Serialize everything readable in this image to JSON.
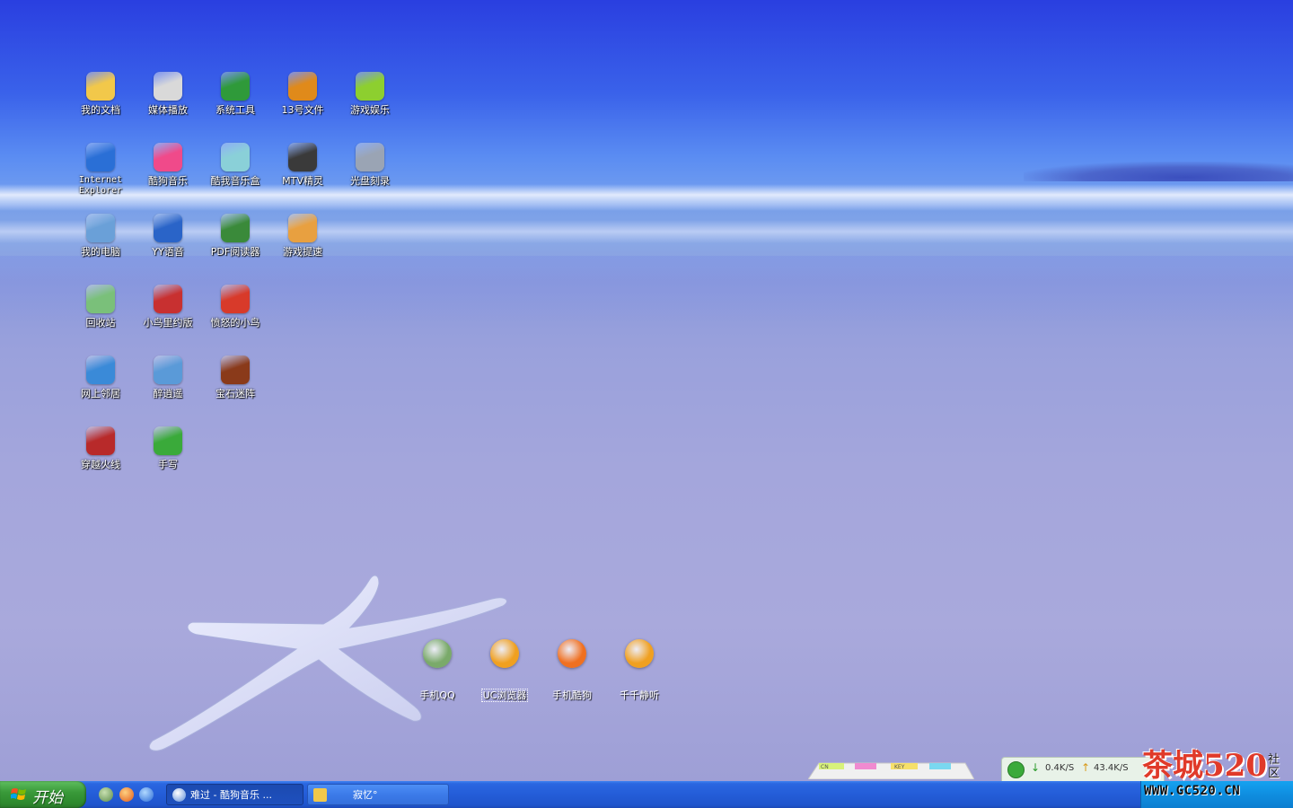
{
  "desktop_icons": [
    {
      "label": "我的文档",
      "icon": "my-documents-icon",
      "color": "#f2c84a"
    },
    {
      "label": "媒体播放",
      "icon": "media-player-icon",
      "color": "#d9d9d9"
    },
    {
      "label": "系统工具",
      "icon": "system-tools-icon",
      "color": "#2f9a3a"
    },
    {
      "label": "13号文件",
      "icon": "file-box-icon",
      "color": "#e08a1a"
    },
    {
      "label": "游戏娱乐",
      "icon": "android-games-icon",
      "color": "#8dcf2f"
    },
    {
      "label": "Internet Explorer",
      "icon": "internet-explorer-icon",
      "color": "#2a6fd6"
    },
    {
      "label": "酷狗音乐",
      "icon": "kugou-music-icon",
      "color": "#f04a8a"
    },
    {
      "label": "酷我音乐盒",
      "icon": "kuwo-music-icon",
      "color": "#8ad0d8"
    },
    {
      "label": "MTV精灵",
      "icon": "mtv-speaker-icon",
      "color": "#3a3a3a"
    },
    {
      "label": "光盘刻录",
      "icon": "disc-burner-icon",
      "color": "#9aa4b4"
    },
    {
      "label": "我的电脑",
      "icon": "my-computer-icon",
      "color": "#6aa0d8"
    },
    {
      "label": "YY语音",
      "icon": "yy-voice-icon",
      "color": "#2a64c8"
    },
    {
      "label": "PDF阅读器",
      "icon": "pdf-reader-icon",
      "color": "#3a8a3a"
    },
    {
      "label": "游戏提速",
      "icon": "game-boost-icon",
      "color": "#e8a040"
    },
    {
      "label": "回收站",
      "icon": "recycle-bin-icon",
      "color": "#7ac07a"
    },
    {
      "label": "小鸟里约版",
      "icon": "angry-birds-rio-icon",
      "color": "#c83030"
    },
    {
      "label": "愤怒的小鸟",
      "icon": "angry-birds-icon",
      "color": "#d83a2a"
    },
    {
      "label": "网上邻居",
      "icon": "network-places-icon",
      "color": "#3a8ad8"
    },
    {
      "label": "醉逍遥",
      "icon": "zuixiaoyao-icon",
      "color": "#5a9ad8"
    },
    {
      "label": "宝石迷阵",
      "icon": "bejeweled-icon",
      "color": "#8a3a1a"
    },
    {
      "label": "穿越火线",
      "icon": "crossfire-icon",
      "color": "#b82a2a"
    },
    {
      "label": "手写",
      "icon": "handwriting-icon",
      "color": "#3aaa3a"
    }
  ],
  "dock_icons": [
    {
      "label": "手机QQ",
      "icon": "alien-face-icon",
      "color": "#7aaa6a"
    },
    {
      "label": "UC浏览器",
      "icon": "smile-face-icon",
      "color": "#f0a020"
    },
    {
      "label": "手机酷狗",
      "icon": "heart-eyes-face-icon",
      "color": "#f07020"
    },
    {
      "label": "千千静听",
      "icon": "sad-face-icon",
      "color": "#f0a020"
    }
  ],
  "ime_toolbar": [
    "CN",
    "♪",
    "KEY",
    "?"
  ],
  "tray": {
    "download_speed": "0.4K/S",
    "upload_speed": "43.4K/S",
    "watermark_text": "茶城520",
    "watermark_side": "社区",
    "watermark_url": "WWW.GC520.CN"
  },
  "taskbar": {
    "start_label": "开始",
    "quick_launch": [
      "alien-quicklaunch-icon",
      "kugou-quicklaunch-icon",
      "ie-quicklaunch-icon"
    ],
    "tasks": [
      {
        "label": "难过 - 酷狗音乐 ...",
        "icon": "kugou-task-icon",
        "active": true
      },
      {
        "label": "寂忆°",
        "icon": "folder-task-icon",
        "active": false
      }
    ]
  }
}
